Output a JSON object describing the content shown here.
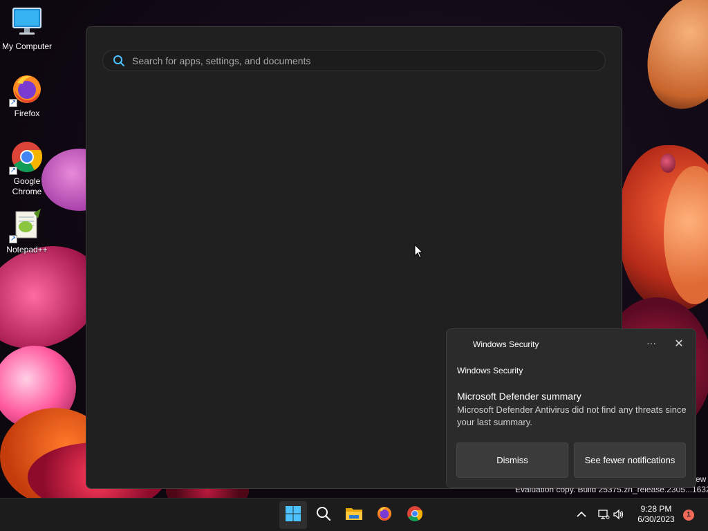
{
  "desktop": {
    "icons": [
      {
        "label": "My Computer",
        "icon": "monitor-icon"
      },
      {
        "label": "Firefox",
        "icon": "firefox-icon"
      },
      {
        "label": "Google\nChrome",
        "icon": "chrome-icon"
      },
      {
        "label": "Notepad++",
        "icon": "notepad-plus-plus-icon"
      }
    ]
  },
  "search": {
    "placeholder": "Search for apps, settings, and documents"
  },
  "watermark": {
    "line1": "ew",
    "line2": "Evaluation copy. Build 25375.zn_release.2305...1632"
  },
  "toast": {
    "app_name": "Windows Security",
    "more_label": "···",
    "close_label": "✕",
    "source": "Windows Security",
    "title": "Microsoft Defender summary",
    "body": "Microsoft Defender Antivirus did not find any threats since your last summary.",
    "dismiss_label": "Dismiss",
    "fewer_label": "See fewer notifications"
  },
  "taskbar": {
    "apps": [
      {
        "name": "start",
        "icon": "windows-logo-icon"
      },
      {
        "name": "search",
        "icon": "search-icon"
      },
      {
        "name": "file-explorer",
        "icon": "folder-icon"
      },
      {
        "name": "firefox",
        "icon": "firefox-icon"
      },
      {
        "name": "chrome",
        "icon": "chrome-icon"
      }
    ],
    "time": "9:28 PM",
    "date": "6/30/2023",
    "notification_count": "1"
  },
  "colors": {
    "panel_bg": "#202020",
    "toast_bg": "#2b2b2b",
    "taskbar_bg": "#1c1c1c",
    "accent_blue": "#4cc2ff",
    "badge": "#f06a5a"
  }
}
